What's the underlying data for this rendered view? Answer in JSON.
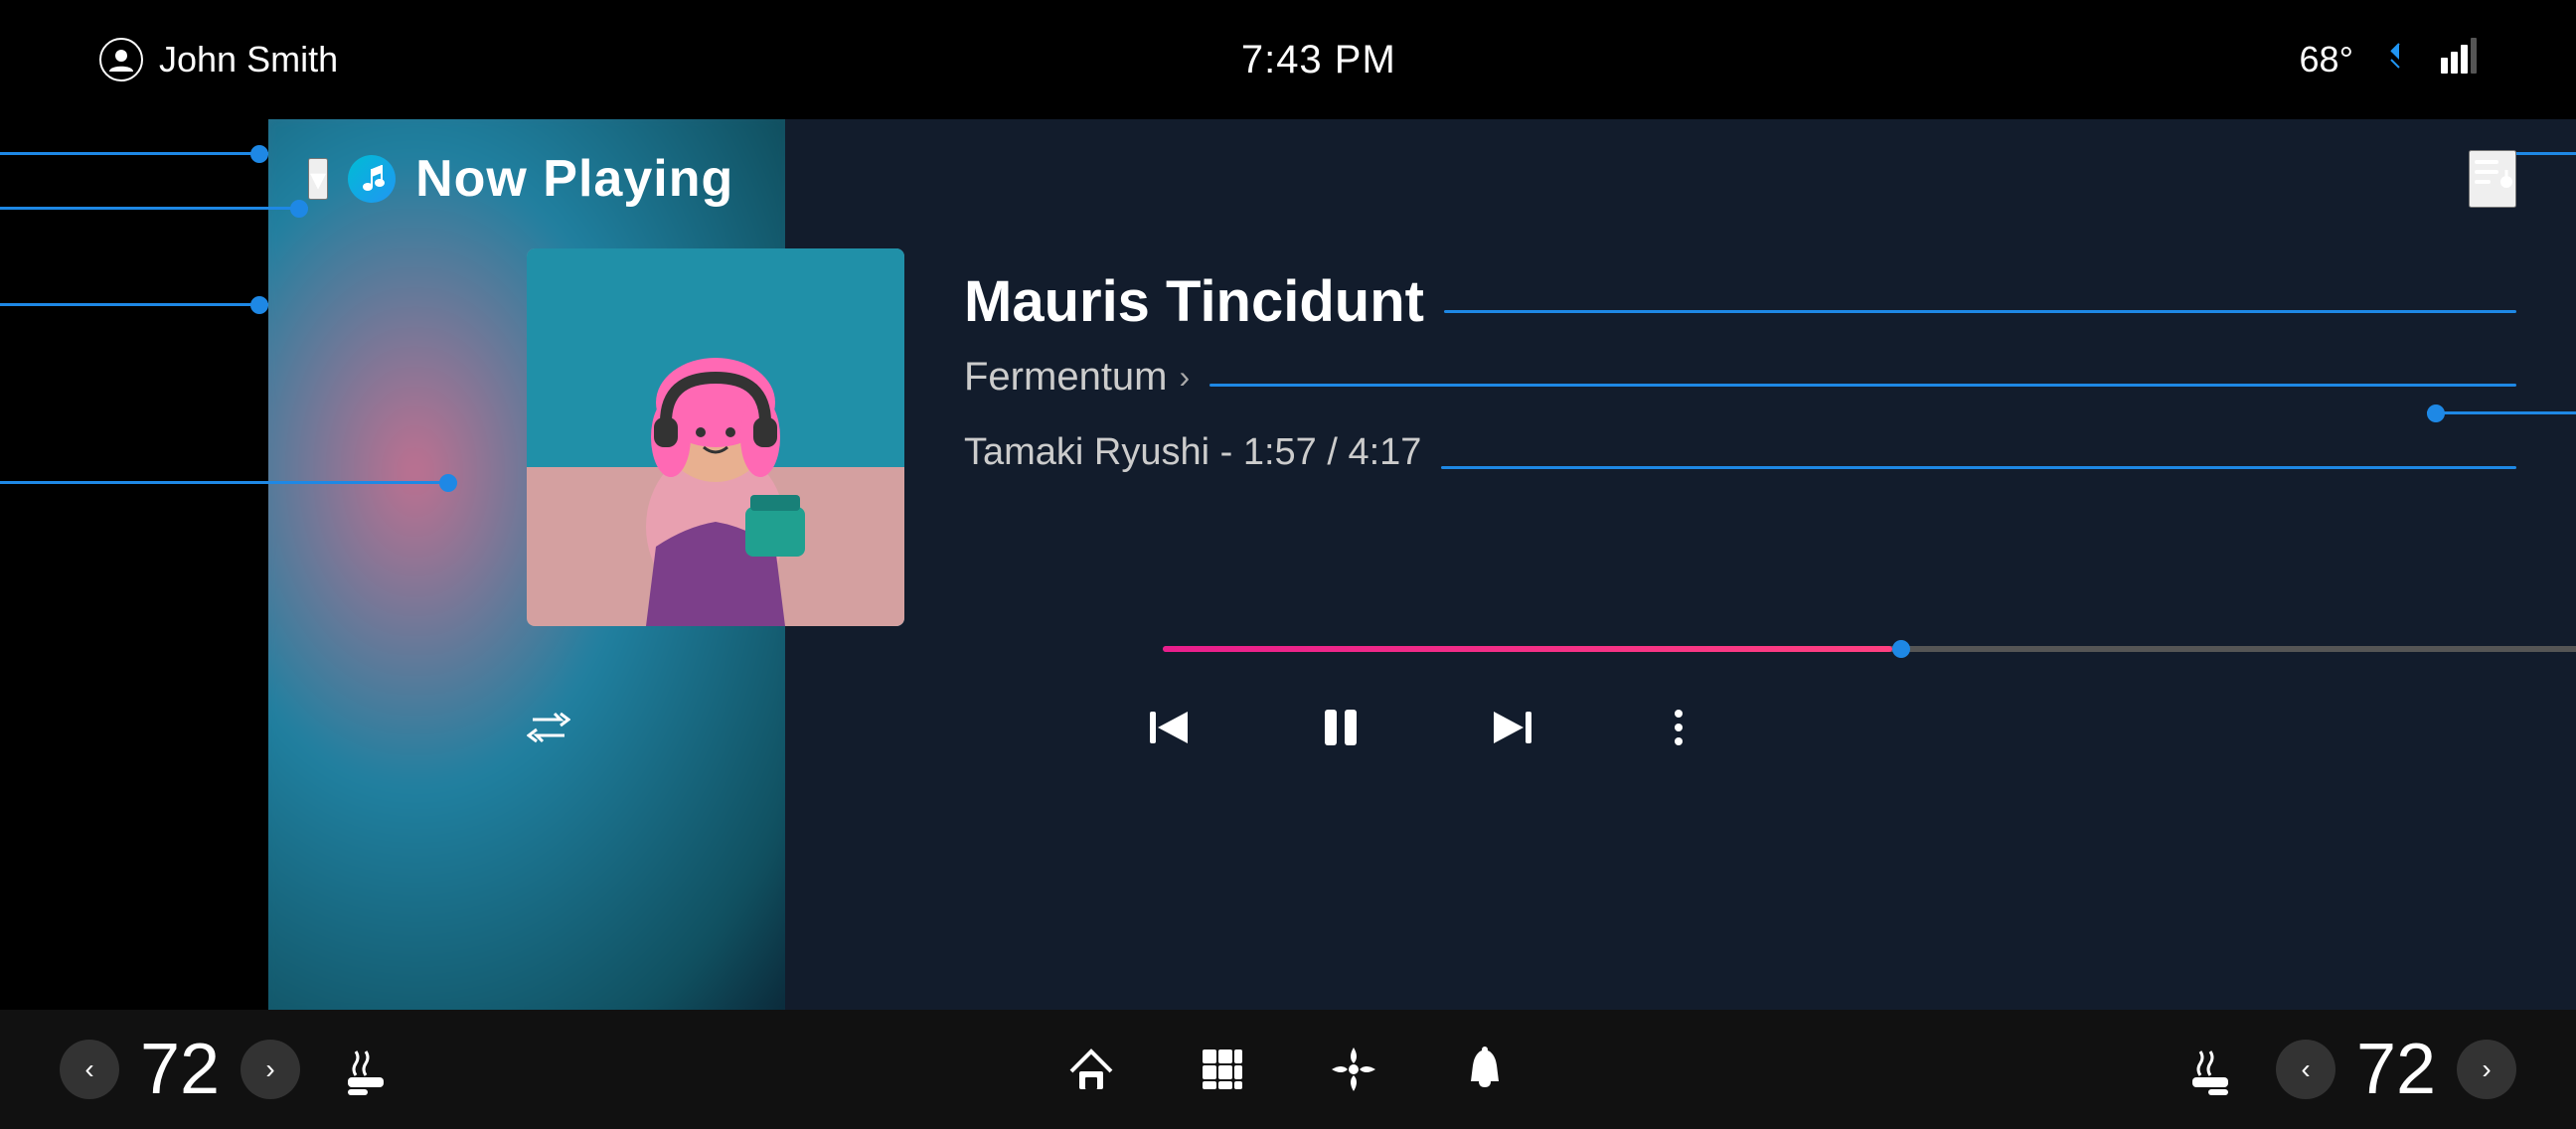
{
  "statusBar": {
    "user": "John Smith",
    "time": "7:43 PM",
    "temperature": "68°",
    "bluetooth": "bluetooth",
    "signal": "signal"
  },
  "player": {
    "title": "Now Playing",
    "song": {
      "name": "Mauris Tincidunt",
      "album": "Fermentum",
      "artistTime": "Tamaki Ryushi - 1:57 / 4:17",
      "currentTime": "1:57",
      "totalTime": "4:17",
      "artist": "Tamaki Ryushi",
      "progressPercent": 47
    },
    "controls": {
      "repeat": "⇄",
      "previous": "⏮",
      "pause": "⏸",
      "next": "⏭",
      "more": "⋮",
      "queue": "queue"
    }
  },
  "bottomNav": {
    "leftTemp": {
      "value": "72",
      "decreaseLabel": "‹",
      "increaseLabel": "›",
      "icon": "seat-heat-icon"
    },
    "rightTemp": {
      "value": "72",
      "decreaseLabel": "‹",
      "increaseLabel": "›",
      "icon": "seat-heat-icon"
    },
    "center": {
      "home": "home",
      "apps": "apps",
      "fan": "fan",
      "bell": "bell"
    }
  }
}
